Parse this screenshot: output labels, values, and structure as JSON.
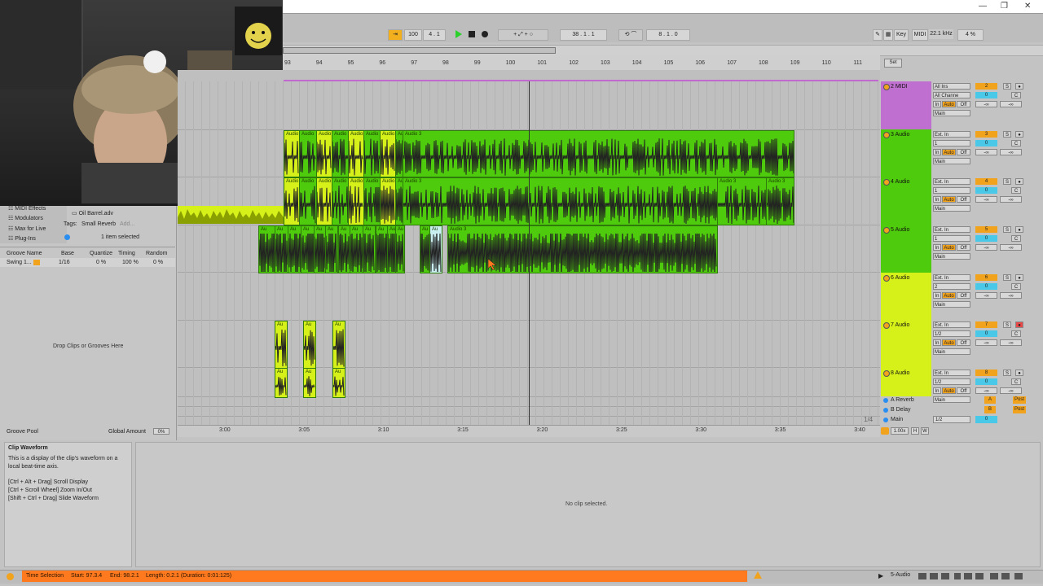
{
  "window": {
    "minimize": "—",
    "restore": "❐",
    "close": "✕"
  },
  "transport": {
    "tempo": "100",
    "signature": "4 . 1",
    "position": "38 . 1 . 1",
    "loop_length": "8 . 1 . 0",
    "key_label": "Key",
    "midi_label": "MIDI",
    "sample_rate": "22.1 kHz",
    "cpu": "4 %"
  },
  "ruler": {
    "bars": [
      "93",
      "94",
      "95",
      "96",
      "97",
      "98",
      "99",
      "100",
      "101",
      "102",
      "103",
      "104",
      "105",
      "106",
      "107",
      "108",
      "109",
      "110",
      "111"
    ],
    "set_label": "Set"
  },
  "time_ruler": {
    "marks": [
      "3:00",
      "3:05",
      "3:10",
      "3:15",
      "3:20",
      "3:25",
      "3:30",
      "3:35",
      "3:40"
    ],
    "zoom_fraction": "1/4"
  },
  "clips": {
    "audio": "Audio",
    "audio_short": "Au",
    "audio3": "Audio 3",
    "audio3_short": "Audio 3"
  },
  "tracks": [
    {
      "name": "2 MIDI",
      "num": "2",
      "input": "All Ins",
      "channel": "All Channe",
      "out": "Main",
      "color": "#bf6fcf"
    },
    {
      "name": "3 Audio",
      "num": "3",
      "input": "Ext. In",
      "channel": "1",
      "out": "Main",
      "color": "#4ecb0c"
    },
    {
      "name": "4 Audio",
      "num": "4",
      "input": "Ext. In",
      "channel": "1",
      "out": "Main",
      "color": "#4ecb0c"
    },
    {
      "name": "5 Audio",
      "num": "5",
      "input": "Ext. In",
      "channel": "1",
      "out": "Main",
      "color": "#4ecb0c"
    },
    {
      "name": "6 Audio",
      "num": "6",
      "input": "Ext. In",
      "channel": "2",
      "out": "Main",
      "color": "#d6f01a"
    },
    {
      "name": "7 Audio",
      "num": "7",
      "input": "Ext. In",
      "channel": "1/2",
      "out": "Main",
      "color": "#d6f01a"
    },
    {
      "name": "8 Audio",
      "num": "8",
      "input": "Ext. In",
      "channel": "1/2",
      "out": "Main",
      "color": "#d6f01a"
    }
  ],
  "io_labels": {
    "in": "In",
    "auto": "Auto",
    "off": "Off",
    "s": "S",
    "c": "C",
    "zero": "0",
    "neg_inf": "-∞"
  },
  "returns": [
    {
      "name": "A Reverb",
      "letter": "A",
      "post": "Post",
      "color": "#b8b3f0"
    },
    {
      "name": "B Delay",
      "letter": "B",
      "post": "Post",
      "color": "#6ad6e6"
    },
    {
      "name": "Main",
      "channel": "1/2",
      "zero": "0",
      "color": "#7a8cf0"
    }
  ],
  "master": {
    "tempo_display": "1.00x",
    "h": "H",
    "w": "W"
  },
  "browser": {
    "categories": [
      "MIDI Effects",
      "Modulators",
      "Max for Live",
      "Plug-Ins"
    ],
    "file": "Oil Barrel.adv",
    "tags_label": "Tags:",
    "tag": "Small Reverb",
    "add": "Add...",
    "selected": "1 item selected"
  },
  "groove": {
    "headers": [
      "Groove Name",
      "Base",
      "Quantize",
      "Timing",
      "Random"
    ],
    "row": {
      "name": "Swing 1...",
      "base": "1/16",
      "quantize": "0 %",
      "timing": "100 %",
      "random": "0 %"
    },
    "drop_text": "Drop Clips or Grooves Here",
    "pool": "Groove Pool",
    "global_amount_label": "Global Amount",
    "global_amount": "0%"
  },
  "info": {
    "title": "Clip Waveform",
    "body": "This is a display of the clip's waveform on a local beat-time axis.",
    "shortcuts": [
      "[Ctrl + Alt + Drag] Scroll Display",
      "[Ctrl + Scroll Wheel] Zoom In/Out",
      "[Shift + Ctrl + Drag] Slide Waveform"
    ]
  },
  "clip_view": {
    "empty": "No clip selected."
  },
  "status": {
    "mode": "Time Selection",
    "start": "Start: 97.3.4",
    "end": "End: 98.2.1",
    "length": "Length: 0.2.1 (Duration: 0:01:125)",
    "track": "5-Audio"
  }
}
